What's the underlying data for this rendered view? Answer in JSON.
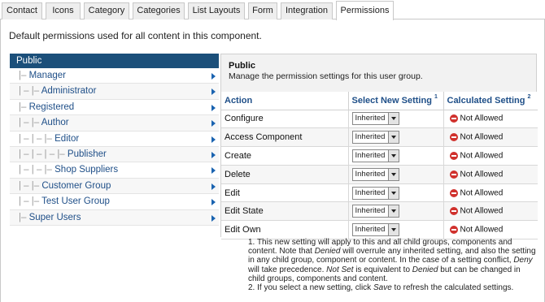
{
  "tabs": [
    "Contact",
    "Icons",
    "Category",
    "Categories",
    "List Layouts",
    "Form",
    "Integration",
    "Permissions"
  ],
  "active_tab": "Permissions",
  "intro": "Default permissions used for all content in this component.",
  "groups": [
    {
      "prefix": "",
      "label": "Public"
    },
    {
      "prefix": "|–",
      "label": "Manager"
    },
    {
      "prefix": "|  –  |–",
      "label": "Administrator"
    },
    {
      "prefix": "|–",
      "label": "Registered"
    },
    {
      "prefix": "|  –  |–",
      "label": "Author"
    },
    {
      "prefix": "|  –  |  –  |–",
      "label": "Editor"
    },
    {
      "prefix": "|  –  |  –  |  –  |–",
      "label": "Publisher"
    },
    {
      "prefix": "|  –  |  –  |–",
      "label": "Shop Suppliers"
    },
    {
      "prefix": "|  –  |–",
      "label": "Customer Group"
    },
    {
      "prefix": "|  –  |–",
      "label": "Test User Group"
    },
    {
      "prefix": "|–",
      "label": "Super Users"
    }
  ],
  "panel": {
    "title": "Public",
    "description": "Manage the permission settings for this user group.",
    "col_action": "Action",
    "col_select": "Select New Setting",
    "col_select_sup": "1",
    "col_calc": "Calculated Setting",
    "col_calc_sup": "2",
    "rows": [
      {
        "action": "Configure",
        "setting": "Inherited",
        "calculated": "Not Allowed"
      },
      {
        "action": "Access Component",
        "setting": "Inherited",
        "calculated": "Not Allowed"
      },
      {
        "action": "Create",
        "setting": "Inherited",
        "calculated": "Not Allowed"
      },
      {
        "action": "Delete",
        "setting": "Inherited",
        "calculated": "Not Allowed"
      },
      {
        "action": "Edit",
        "setting": "Inherited",
        "calculated": "Not Allowed"
      },
      {
        "action": "Edit State",
        "setting": "Inherited",
        "calculated": "Not Allowed"
      },
      {
        "action": "Edit Own",
        "setting": "Inherited",
        "calculated": "Not Allowed"
      }
    ]
  },
  "notes": {
    "n1_a": "1. This new setting will apply to this and all child groups, components and content. Note that ",
    "n1_denied": "Denied",
    "n1_b": " will overrule any inherited setting, and also the setting in any child group, component or content. In the case of a setting conflict, ",
    "n1_deny": "Deny",
    "n1_c": " will take precedence. ",
    "n1_notset": "Not Set",
    "n1_d": " is equivalent to ",
    "n1_denied2": "Denied",
    "n1_e": " but can be changed in child groups, components and content.",
    "n2_a": "2. If you select a new setting, click ",
    "n2_save": "Save",
    "n2_b": " to refresh the calculated settings."
  },
  "icons": {
    "arrow": "arrow-right-icon",
    "deny": "deny-icon",
    "dropdown": "chevron-down-icon"
  },
  "colors": {
    "active_group": "#1b4f7a",
    "link": "#1f4f88",
    "deny": "#d0312d"
  }
}
